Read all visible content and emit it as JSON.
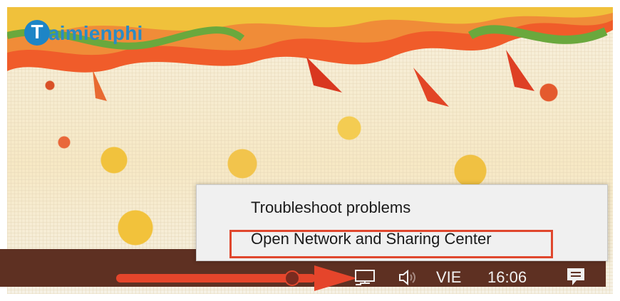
{
  "watermark": {
    "brand_text": "aimienphi",
    "badge_letter": "T"
  },
  "context_menu": {
    "items": [
      {
        "label": "Troubleshoot problems"
      },
      {
        "label": "Open Network and Sharing Center"
      }
    ],
    "highlighted_index": 1
  },
  "taskbar": {
    "language": "VIE",
    "time": "16:06",
    "icons": [
      "network-icon",
      "volume-icon",
      "action-center-icon"
    ]
  },
  "annotation": {
    "arrow_color": "#e5452b",
    "highlight_color": "#e0472d"
  },
  "colors": {
    "taskbar": "#5e3022",
    "menu_background": "#f0f0f0"
  }
}
